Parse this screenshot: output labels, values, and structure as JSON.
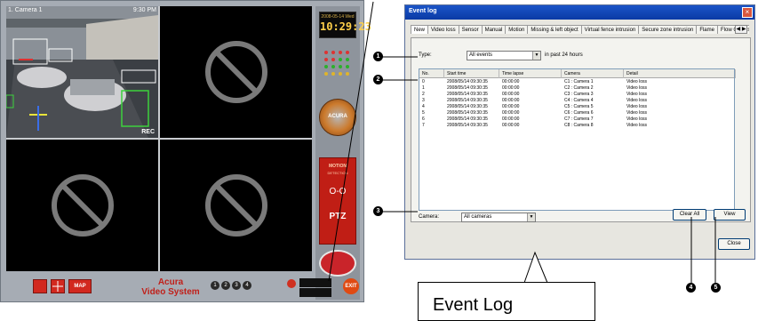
{
  "dvr": {
    "cam1_title": "1. Camera 1",
    "cam1_time": "9:30 PM",
    "rec_label": "REC",
    "clock_date": "2008-05-14 Wed",
    "clock_time": "10:29:23",
    "badge_text": "ACURA",
    "panel_line1": "MOTION",
    "panel_line2": "DETECTION",
    "panel_icon": "O-O",
    "ptz_label": "PTZ",
    "layout_single": "",
    "layout_quad": "",
    "map_label": "MAP",
    "brand_line1": "Acura",
    "brand_line2": "Video System",
    "pages": [
      "1",
      "2",
      "3",
      "4"
    ],
    "exit_label": "EXIT"
  },
  "dialog": {
    "title": "Event log",
    "close_glyph": "×",
    "tabs": [
      "New",
      "Video loss",
      "Sensor",
      "Manual",
      "Motion",
      "Missing & left object",
      "Virtual fence intrusion",
      "Secure zone intrusion",
      "Flame",
      "Flow Counts"
    ],
    "tab_scroll": "◀ ▶",
    "type_label": "Type:",
    "type_value": "All events",
    "period_label": "in past 24 hours",
    "columns": [
      "No.",
      "Start time",
      "Time lapse",
      "Camera",
      "Detail"
    ],
    "rows": [
      [
        "0",
        "2008/05/14 09:30:35",
        "00:00:00",
        "C1 : Camera 1",
        "Video loss"
      ],
      [
        "1",
        "2008/05/14 09:30:35",
        "00:00:00",
        "C2 : Camera 2",
        "Video loss"
      ],
      [
        "2",
        "2008/05/14 09:30:35",
        "00:00:00",
        "C3 : Camera 3",
        "Video loss"
      ],
      [
        "3",
        "2008/05/14 09:30:35",
        "00:00:00",
        "C4 : Camera 4",
        "Video loss"
      ],
      [
        "4",
        "2008/05/14 09:30:35",
        "00:00:00",
        "C5 : Camera 5",
        "Video loss"
      ],
      [
        "5",
        "2008/05/14 09:30:35",
        "00:00:00",
        "C6 : Camera 6",
        "Video loss"
      ],
      [
        "6",
        "2008/05/14 09:30:35",
        "00:00:00",
        "C7 : Camera 7",
        "Video loss"
      ],
      [
        "7",
        "2008/05/14 09:30:35",
        "00:00:00",
        "C8 : Camera 8",
        "Video loss"
      ]
    ],
    "camera_label": "Camera:",
    "camera_value": "All cameras",
    "clear_all": "Clear All",
    "view": "View",
    "close": "Close"
  },
  "markers": [
    "1",
    "2",
    "3",
    "4",
    "5"
  ],
  "callout": "Event Log",
  "colors": {
    "titlebar": "#0a3aa5",
    "dvr_frame": "#a6acb4",
    "red_accent": "#c01e15",
    "brand_red": "#c0201a"
  }
}
